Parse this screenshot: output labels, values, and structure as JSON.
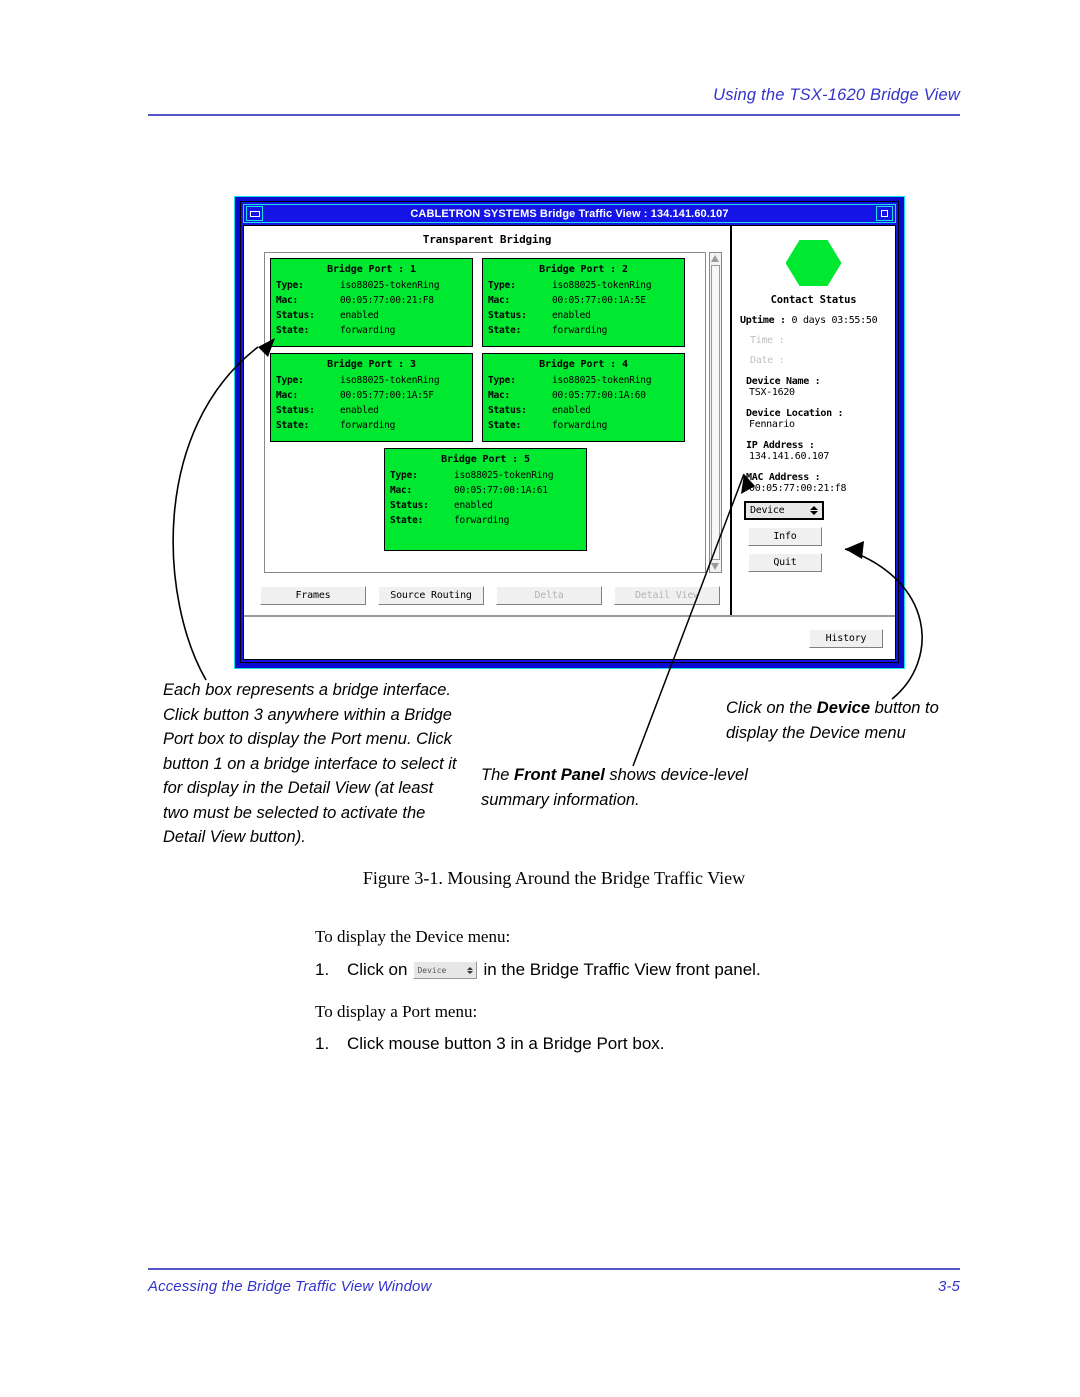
{
  "page": {
    "header_title": "Using the TSX-1620 Bridge View",
    "footer_left": "Accessing the Bridge Traffic View Window",
    "footer_page": "3-5",
    "figure_caption": "Figure 3-1.  Mousing Around the Bridge Traffic View"
  },
  "window": {
    "title": "CABLETRON SYSTEMS Bridge Traffic View : 134.141.60.107",
    "pane_title": "Transparent Bridging",
    "minimize_icon": "minimize-icon",
    "maximize_icon": "maximize-icon"
  },
  "ports": [
    {
      "title": "Bridge Port :  1",
      "fields": [
        {
          "key": "Type:",
          "value": "iso88025-tokenRing"
        },
        {
          "key": "Mac:",
          "value": "00:05:77:00:21:F8"
        },
        {
          "key": "Status:",
          "value": "enabled"
        },
        {
          "key": "State:",
          "value": "forwarding"
        }
      ]
    },
    {
      "title": "Bridge Port :  2",
      "fields": [
        {
          "key": "Type:",
          "value": "iso88025-tokenRing"
        },
        {
          "key": "Mac:",
          "value": "00:05:77:00:1A:5E"
        },
        {
          "key": "Status:",
          "value": "enabled"
        },
        {
          "key": "State:",
          "value": "forwarding"
        }
      ]
    },
    {
      "title": "Bridge Port :  3",
      "fields": [
        {
          "key": "Type:",
          "value": "iso88025-tokenRing"
        },
        {
          "key": "Mac:",
          "value": "00:05:77:00:1A:5F"
        },
        {
          "key": "Status:",
          "value": "enabled"
        },
        {
          "key": "State:",
          "value": "forwarding"
        }
      ]
    },
    {
      "title": "Bridge Port :  4",
      "fields": [
        {
          "key": "Type:",
          "value": "iso88025-tokenRing"
        },
        {
          "key": "Mac:",
          "value": "00:05:77:00:1A:60"
        },
        {
          "key": "Status:",
          "value": "enabled"
        },
        {
          "key": "State:",
          "value": "forwarding"
        }
      ]
    },
    {
      "title": "Bridge Port :  5",
      "fields": [
        {
          "key": "Type:",
          "value": "iso88025-tokenRing"
        },
        {
          "key": "Mac:",
          "value": "00:05:77:00:1A:61"
        },
        {
          "key": "Status:",
          "value": "enabled"
        },
        {
          "key": "State:",
          "value": "forwarding"
        }
      ]
    }
  ],
  "toolbar": {
    "frames": "Frames",
    "source_routing": "Source Routing",
    "delta": "Delta",
    "detail_view": "Detail View"
  },
  "front_panel": {
    "status_icon": "hexagon-status-icon",
    "status_color": "#00e830",
    "contact_status": "Contact Status",
    "uptime_label": "Uptime :",
    "uptime_value": "0 days 03:55:50",
    "time_label": "Time :",
    "date_label": "Date :",
    "device_name_label": "Device Name :",
    "device_name_value": "TSX-1620",
    "device_location_label": "Device Location :",
    "device_location_value": "Fennario",
    "ip_address_label": "IP Address :",
    "ip_address_value": "134.141.60.107",
    "mac_address_label": "MAC Address :",
    "mac_address_value": "00:05:77:00:21:f8",
    "device_button": "Device",
    "info_button": "Info",
    "quit_button": "Quit",
    "history_button": "History"
  },
  "annotations": {
    "left": "Each box represents a bridge interface. Click button 3 anywhere within a Bridge Port box to display the Port menu. Click button 1 on a bridge interface to select it for display in the Detail View (at least two must be selected to activate the Detail View button).",
    "front_panel_pre": "The ",
    "front_panel_bold": "Front Panel",
    "front_panel_post": " shows device-level summary information.",
    "device_pre": "Click on the ",
    "device_bold": "Device",
    "device_post": " button to display the Device menu"
  },
  "body": {
    "lead_device": "To display the Device menu:",
    "step1_num": "1.",
    "step1_pre": "Click on",
    "step1_button": "Device",
    "step1_post": "in the Bridge Traffic View front panel.",
    "lead_port": "To display a Port menu:",
    "step2_num": "1.",
    "step2_text": "Click mouse button 3 in a Bridge Port box."
  }
}
